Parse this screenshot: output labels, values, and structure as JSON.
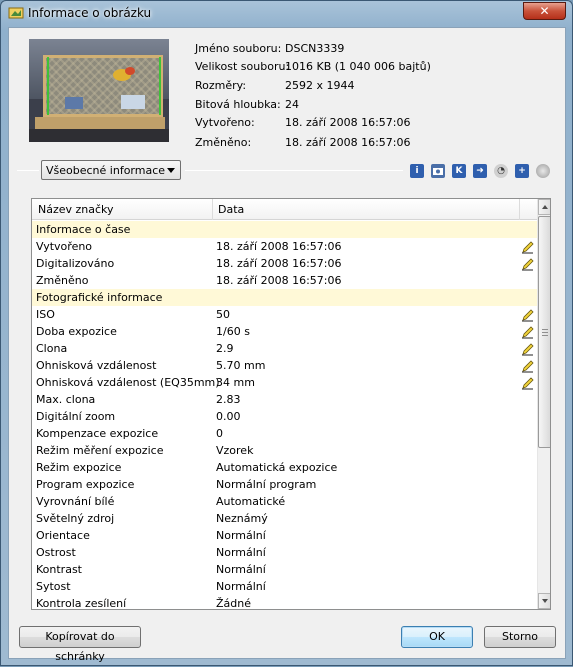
{
  "window": {
    "title": "Informace o obrázku",
    "close_label": "✕"
  },
  "file_info": [
    {
      "label": "Jméno souboru:",
      "value": "DSCN3339"
    },
    {
      "label": "Velikost souboru:",
      "value": "1016 KB (1 040 006 bajtů)"
    },
    {
      "label": "Rozměry:",
      "value": "2592 x 1944"
    },
    {
      "label": "Bitová hloubka:",
      "value": "24"
    },
    {
      "label": "Vytvořeno:",
      "value": "18. září 2008 16:57:06"
    },
    {
      "label": "Změněno:",
      "value": "18. září 2008 16:57:06"
    }
  ],
  "view_select": {
    "selected": "Všeobecné informace"
  },
  "toolbar_icons": [
    "info-icon",
    "camera-icon",
    "k-icon",
    "arrow-icon",
    "gps-icon",
    "plus-icon",
    "circle-icon"
  ],
  "table": {
    "headers": [
      "Název značky",
      "Data"
    ],
    "rows": [
      {
        "section": true,
        "name": "Informace o čase",
        "value": ""
      },
      {
        "name": "Vytvořeno",
        "value": "18. září 2008 16:57:06",
        "editable": true
      },
      {
        "name": "Digitalizováno",
        "value": "18. září 2008 16:57:06",
        "editable": true
      },
      {
        "name": "Změněno",
        "value": "18. září 2008 16:57:06",
        "editable": false
      },
      {
        "section": true,
        "name": "Fotografické informace",
        "value": ""
      },
      {
        "name": "ISO",
        "value": "50",
        "editable": true
      },
      {
        "name": "Doba expozice",
        "value": "1/60 s",
        "editable": true
      },
      {
        "name": "Clona",
        "value": "2.9",
        "editable": true
      },
      {
        "name": "Ohnisková vzdálenost",
        "value": "5.70 mm",
        "editable": true
      },
      {
        "name": "Ohnisková vzdálenost (EQ35mm)",
        "value": "34 mm",
        "editable": true
      },
      {
        "name": "Max. clona",
        "value": "2.83",
        "editable": false
      },
      {
        "name": "Digitální zoom",
        "value": "0.00",
        "editable": false
      },
      {
        "name": "Kompenzace expozice",
        "value": "0",
        "editable": false
      },
      {
        "name": "Režim měření expozice",
        "value": "Vzorek",
        "editable": false
      },
      {
        "name": "Režim expozice",
        "value": "Automatická expozice",
        "editable": false
      },
      {
        "name": "Program expozice",
        "value": "Normální program",
        "editable": false
      },
      {
        "name": "Vyrovnání bílé",
        "value": "Automatické",
        "editable": false
      },
      {
        "name": "Světelný zdroj",
        "value": "Neznámý",
        "editable": false
      },
      {
        "name": "Orientace",
        "value": "Normální",
        "editable": false
      },
      {
        "name": "Ostrost",
        "value": "Normální",
        "editable": false
      },
      {
        "name": "Kontrast",
        "value": "Normální",
        "editable": false
      },
      {
        "name": "Sytost",
        "value": "Normální",
        "editable": false
      },
      {
        "name": "Kontrola zesílení",
        "value": "Žádné",
        "editable": false
      }
    ]
  },
  "buttons": {
    "copy": "Kopírovat do schránky",
    "ok": "OK",
    "cancel": "Storno"
  }
}
